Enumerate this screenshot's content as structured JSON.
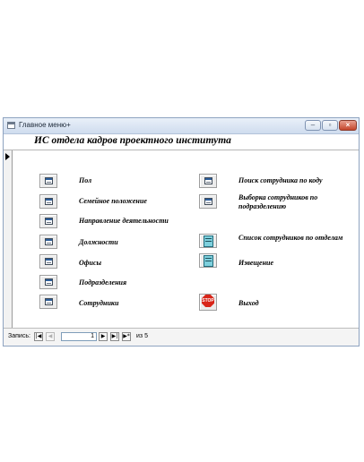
{
  "window": {
    "title": "Главное меню+"
  },
  "form": {
    "title": "ИС отдела кадров проектного института"
  },
  "left_buttons": [
    {
      "label": "Пол"
    },
    {
      "label": "Семейное положение"
    },
    {
      "label": "Направление деятельности"
    },
    {
      "label": "Должности"
    },
    {
      "label": "Офисы"
    },
    {
      "label": "Подразделения"
    },
    {
      "label": "Сотрудники"
    }
  ],
  "right_buttons": [
    {
      "label": "Поиск сотрудника по коду"
    },
    {
      "label": "Выборка сотрудников по подразделению"
    },
    {
      "label": "Список сотрудников по отделам"
    },
    {
      "label": "Извещение"
    },
    {
      "label": "Выход",
      "icon_text": "STOP"
    }
  ],
  "navigation": {
    "label": "Запись:",
    "current_record": "1",
    "of_label": "из",
    "total_records": "5"
  },
  "colors": {
    "stop": "#d8261a",
    "close_button": "#c4452b",
    "title_bar": "#cfdcee"
  }
}
